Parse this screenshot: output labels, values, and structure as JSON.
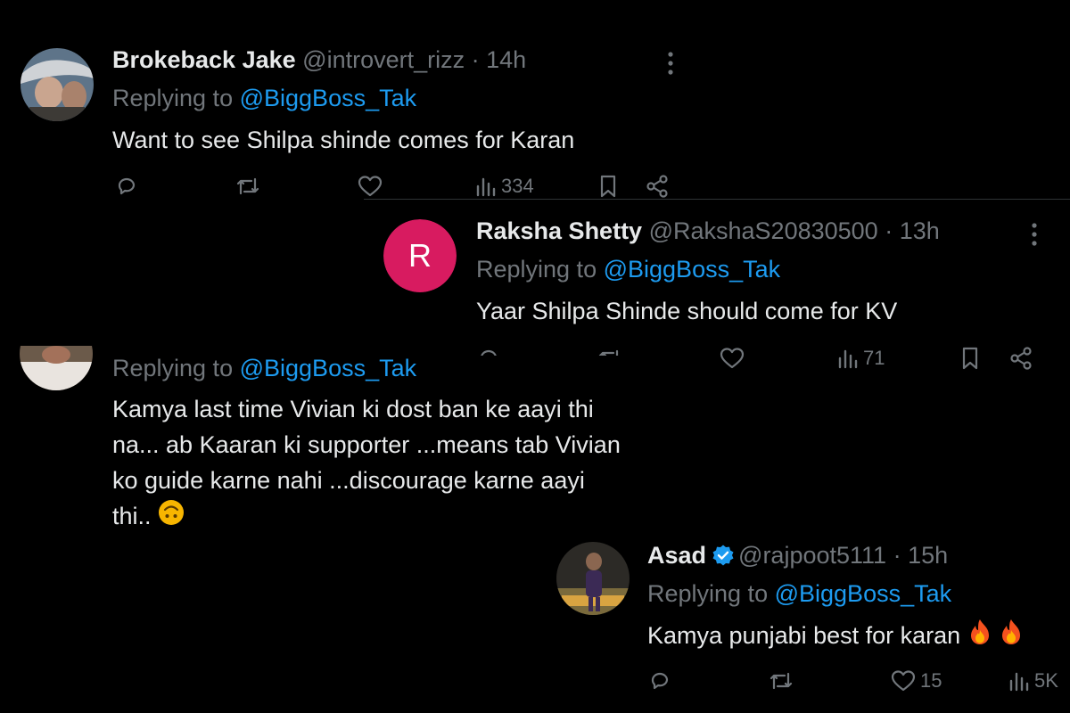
{
  "tweets": {
    "jake": {
      "display_name": "Brokeback Jake",
      "handle": "@introvert_rizz",
      "sep": "·",
      "time": "14h",
      "replying_prefix": "Replying to",
      "replying_handle": "@BiggBoss_Tak",
      "text": "Want to see Shilpa shinde comes for Karan",
      "views": "334"
    },
    "raksha": {
      "display_name": "Raksha Shetty",
      "handle": "@RakshaS20830500",
      "sep": "·",
      "time": "13h",
      "avatar_letter": "R",
      "avatar_color": "#d81b60",
      "replying_prefix": "Replying to",
      "replying_handle": "@BiggBoss_Tak",
      "text": "Yaar Shilpa Shinde should come for KV",
      "views": "71"
    },
    "kamya": {
      "replying_prefix": "Replying to",
      "replying_handle": "@BiggBoss_Tak",
      "text_lines": [
        "Kamya last time Vivian ki dost ban ke aayi thi",
        "na... ab Kaaran ki supporter ...means tab Vivian",
        "ko guide karne nahi ...discourage karne aayi",
        "thi.."
      ],
      "emoji_name": "upside-down-face-emoji"
    },
    "asad": {
      "display_name": "Asad",
      "handle": "@rajpoot5111",
      "sep": "·",
      "time": "15h",
      "replying_prefix": "Replying to",
      "replying_handle": "@BiggBoss_Tak",
      "text": "Kamya punjabi best for karan",
      "emoji_name": "fire-emoji",
      "likes": "15",
      "views": "5K"
    }
  },
  "colors": {
    "background": "#000000",
    "text": "#e7e9ea",
    "muted": "#71767b",
    "mention": "#1d9bf0",
    "verified": "#1d9bf0"
  }
}
